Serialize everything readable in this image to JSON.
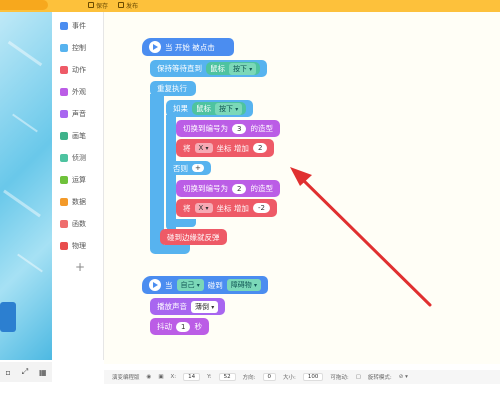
{
  "topbar": {
    "item1": "保存",
    "item2": "发布"
  },
  "categories": [
    {
      "label": "事件",
      "color": "#4b8df0",
      "icon": "event-icon"
    },
    {
      "label": "控制",
      "color": "#57b3ef",
      "icon": "control-icon"
    },
    {
      "label": "动作",
      "color": "#ee5a67",
      "icon": "motion-icon"
    },
    {
      "label": "外观",
      "color": "#bb5de6",
      "icon": "looks-icon"
    },
    {
      "label": "声音",
      "color": "#a866f0",
      "icon": "sound-icon"
    },
    {
      "label": "画笔",
      "color": "#3fb28a",
      "icon": "pen-icon"
    },
    {
      "label": "侦测",
      "color": "#4ec3a0",
      "icon": "sensing-icon"
    },
    {
      "label": "运算",
      "color": "#6fc23b",
      "icon": "operator-icon"
    },
    {
      "label": "数据",
      "color": "#f39a2a",
      "icon": "data-icon"
    },
    {
      "label": "函数",
      "color": "#ef6d6d",
      "icon": "function-icon"
    },
    {
      "label": "物理",
      "color": "#e84c4c",
      "icon": "physics-icon"
    }
  ],
  "blocks": {
    "hat1": "当 开始 被点击",
    "wait_until": "保持等待直到",
    "mouse": "鼠标",
    "pressed": "按下",
    "forever": "重复执行",
    "if": "如果",
    "switch_costume1": "切换到编号为",
    "costume1_num": "3",
    "costume_suffix": "的造型",
    "change_by_prefix": "将",
    "axis_x": "X",
    "coord_increase": "坐标 增加",
    "change1_val": "2",
    "else": "否则",
    "plus": "+",
    "switch_costume2": "切换到编号为",
    "costume2_num": "2",
    "change2_val": "-2",
    "bounce": "碰到边缘就反弹",
    "hat2_when": "当",
    "self": "自己",
    "touch": "碰到",
    "obstacle": "障碍物",
    "play_sound": "播放声音",
    "sound_name": "薄倒",
    "shake": "抖动",
    "shake_val": "1",
    "seconds": "秒"
  },
  "status": {
    "label": "演变编程版",
    "x_label": "X:",
    "x_val": "14",
    "y_label": "Y:",
    "y_val": "52",
    "dir_label": "方向:",
    "dir_val": "0",
    "size_label": "大小:",
    "size_val": "100",
    "drag_label": "可拖动:",
    "rotate_label": "旋转模式:"
  }
}
